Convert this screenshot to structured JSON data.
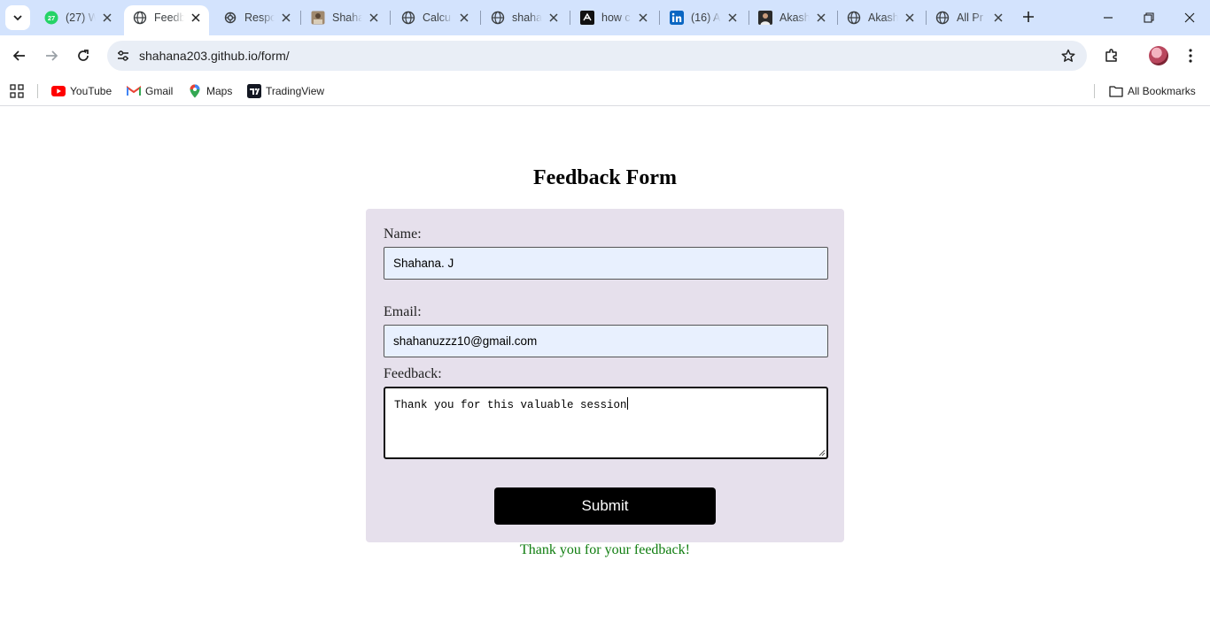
{
  "browser": {
    "tabs": [
      {
        "title": "(27) W",
        "favicon": "whatsapp-icon",
        "badge": "27",
        "active": false
      },
      {
        "title": "Feedb",
        "favicon": "globe-icon",
        "active": true
      },
      {
        "title": "Respo",
        "favicon": "openai-icon",
        "active": false
      },
      {
        "title": "Shaha",
        "favicon": "photo-icon",
        "active": false
      },
      {
        "title": "Calcu",
        "favicon": "globe-icon",
        "active": false
      },
      {
        "title": "shaha",
        "favicon": "globe-icon",
        "active": false
      },
      {
        "title": "how c",
        "favicon": "github-icon",
        "active": false
      },
      {
        "title": "(16) A",
        "favicon": "linkedin-icon",
        "active": false
      },
      {
        "title": "Akash",
        "favicon": "profile-photo-icon",
        "active": false
      },
      {
        "title": "Akash",
        "favicon": "globe-icon",
        "active": false
      },
      {
        "title": "All Pr",
        "favicon": "globe-icon",
        "active": false
      }
    ],
    "url": "shahana203.github.io/form/",
    "bookmarks": [
      {
        "label": "YouTube",
        "icon": "youtube-icon"
      },
      {
        "label": "Gmail",
        "icon": "gmail-icon"
      },
      {
        "label": "Maps",
        "icon": "maps-icon"
      },
      {
        "label": "TradingView",
        "icon": "tradingview-icon"
      }
    ],
    "all_bookmarks_label": "All Bookmarks"
  },
  "page": {
    "title": "Feedback Form",
    "name_label": "Name:",
    "name_value": "Shahana. J",
    "email_label": "Email:",
    "email_value": "shahanuzzz10@gmail.com",
    "feedback_label": "Feedback:",
    "feedback_value": "Thank you for this valuable session",
    "submit_label": "Submit",
    "success_message": "Thank you for your feedback!"
  },
  "colors": {
    "tabstrip": "#d3e3fd",
    "card": "#e6e0ec",
    "input_fill": "#e8f0fe",
    "button": "#000000",
    "success": "#0f7d0f"
  }
}
